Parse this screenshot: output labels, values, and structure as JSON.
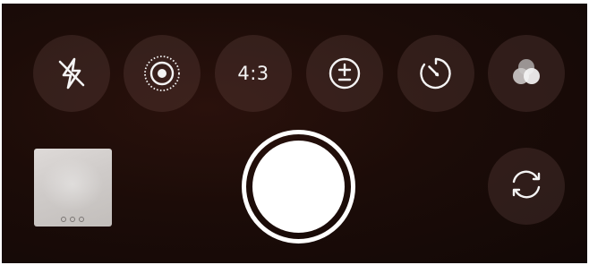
{
  "top_controls": {
    "flash": {
      "icon": "flash-off-icon"
    },
    "live_photo": {
      "icon": "live-photo-icon"
    },
    "aspect_ratio": {
      "label": "4:3"
    },
    "exposure": {
      "icon": "exposure-icon"
    },
    "timer": {
      "icon": "timer-icon"
    },
    "filters": {
      "icon": "filters-icon"
    }
  },
  "bottom_controls": {
    "last_photo": {
      "icon": "photo-thumbnail"
    },
    "shutter": {
      "icon": "shutter-button"
    },
    "switch_camera": {
      "icon": "camera-flip-icon"
    }
  },
  "colors": {
    "background": "#1c0c08",
    "control_fill": "#3a2622",
    "icon": "#f4f4f4",
    "shutter": "#ffffff"
  }
}
